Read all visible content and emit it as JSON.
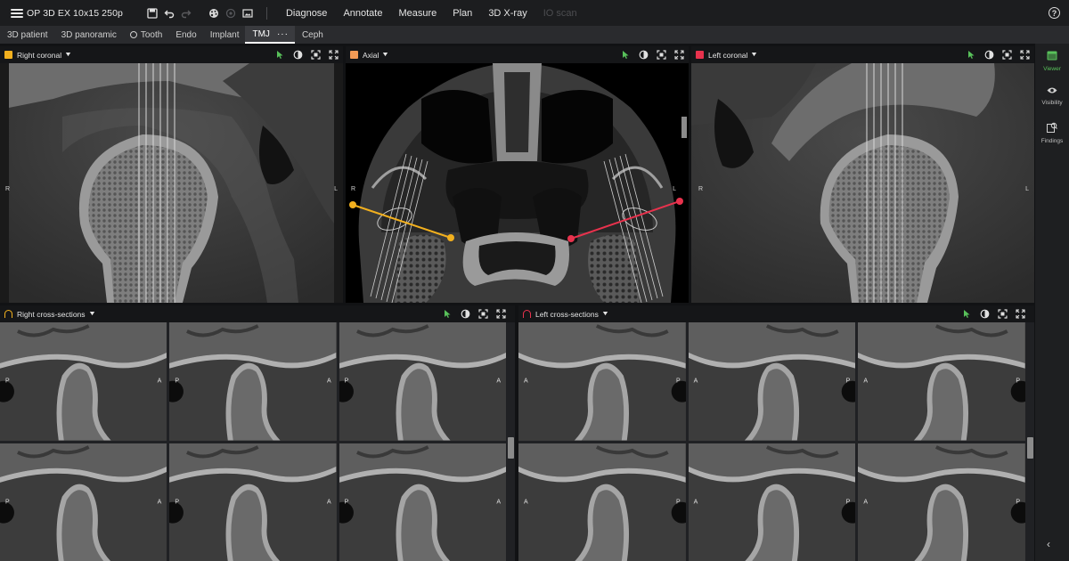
{
  "app": {
    "study_title": "OP 3D EX 10x15 250p",
    "menu": [
      {
        "label": "Diagnose",
        "enabled": true
      },
      {
        "label": "Annotate",
        "enabled": true
      },
      {
        "label": "Measure",
        "enabled": true
      },
      {
        "label": "Plan",
        "enabled": true
      },
      {
        "label": "3D X-ray",
        "enabled": true
      },
      {
        "label": "IO scan",
        "enabled": false
      }
    ],
    "toolbar_icons": [
      "save-icon",
      "undo-icon",
      "redo-icon",
      "palette-icon",
      "camera-icon",
      "screenshot-icon"
    ],
    "help_label": "?"
  },
  "tabs": [
    {
      "label": "3D patient"
    },
    {
      "label": "3D panoramic"
    },
    {
      "label": "Tooth",
      "icon": "tooth-icon"
    },
    {
      "label": "Endo"
    },
    {
      "label": "Implant"
    },
    {
      "label": "TMJ",
      "active": true,
      "more": "···"
    },
    {
      "label": "Ceph"
    }
  ],
  "panels": {
    "right_coronal": {
      "title": "Right coronal",
      "color": "#f2b01e",
      "orient_left": "R",
      "orient_right": "L"
    },
    "axial": {
      "title": "Axial",
      "color": "#f29a55",
      "orient_left": "R",
      "orient_right": "L"
    },
    "left_coronal": {
      "title": "Left coronal",
      "color": "#e8324d",
      "orient_left": "R",
      "orient_right": "L"
    },
    "right_cross": {
      "title": "Right cross-sections",
      "orient_left": "P",
      "orient_right": "A"
    },
    "left_cross": {
      "title": "Left cross-sections",
      "orient_left": "A",
      "orient_right": "P"
    }
  },
  "panel_tool_icons": [
    "cursor-icon",
    "contrast-icon",
    "fit-icon",
    "fullscreen-icon"
  ],
  "sidebar": {
    "items": [
      {
        "label": "Viewer",
        "icon": "viewer-icon",
        "active": true
      },
      {
        "label": "Visibility",
        "icon": "eye-icon",
        "active": false
      },
      {
        "label": "Findings",
        "icon": "findings-icon",
        "active": false
      }
    ],
    "collapse_glyph": "‹"
  },
  "colors": {
    "accent_green": "#58c15a",
    "right_marker": "#f2b01e",
    "left_marker": "#e8324d"
  }
}
